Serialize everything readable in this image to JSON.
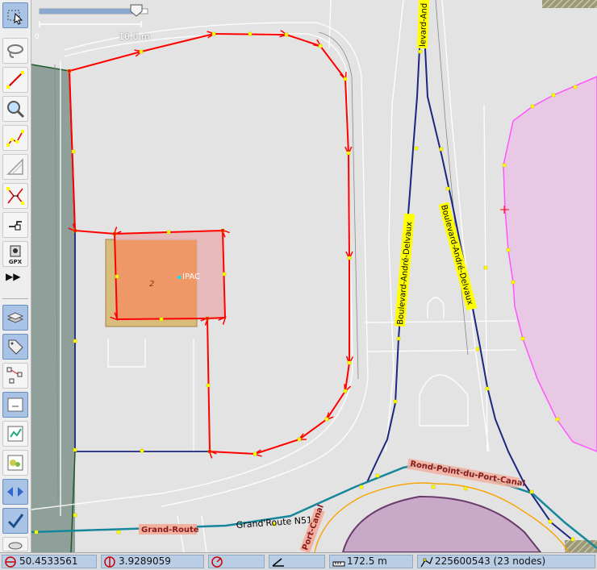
{
  "status": {
    "latitude": "50.4533561",
    "longitude": "3.9289059",
    "heading": "",
    "angle": "",
    "distance": "172.5 m",
    "selection": "225600543 (23 nodes)"
  },
  "scale": {
    "label": "10.0 m",
    "slider_fraction": 0.9
  },
  "map": {
    "labels": {
      "ipac": "IPAC",
      "building_number": "2",
      "street_top": "levard-And",
      "street_left": "Boulevard-André-Delvaux",
      "street_right": "Boulevard-André-Delvaux",
      "roundabout": "Rond-Point-du-Port-Canal",
      "grand_route": "Grand-Route",
      "grand_route_n51": "Grand'Route N51",
      "port_canal": "Port-Canal"
    }
  },
  "toolbar": {
    "icons": [
      "select-icon",
      "lasso-icon",
      "draw-icon",
      "zoom-icon",
      "delete-icon",
      "parallel-icon",
      "split-icon",
      "extrude-icon",
      "gpx-icon",
      "more-icon",
      "layers-icon",
      "tags-icon",
      "relations-icon",
      "history-icon",
      "validator-icon",
      "filter-icon",
      "conflict-icon",
      "done-icon",
      "minimap-icon"
    ],
    "gpx_label": "GPX",
    "more_label": "▶▶"
  },
  "colors": {
    "selection_way": "#ff0000",
    "way_nodes": "#ffff00",
    "primary_road": "#1a2780",
    "landuse_pink": "#e9c8e6",
    "landuse_pink_border": "#ff55ff",
    "roundabout_teal": "#16879a",
    "orange_way": "#f7a400",
    "building_fill": "#f0955f"
  }
}
